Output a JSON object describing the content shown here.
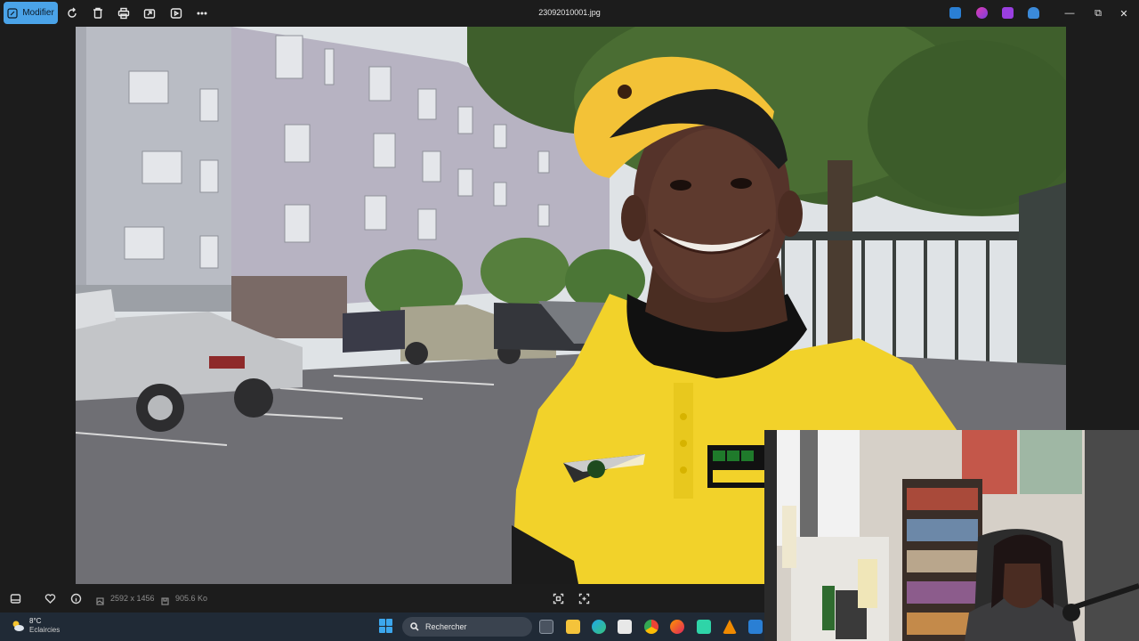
{
  "toolbar": {
    "edit_label": "Modifier",
    "file_name": "23092010001.jpg",
    "icons": [
      "rotate-icon",
      "delete-icon",
      "print-icon",
      "share-icon",
      "slideshow-icon",
      "more-icon"
    ]
  },
  "window_controls": {
    "minimize": "—",
    "maximize": "⧉",
    "close": "✕"
  },
  "status": {
    "dimensions": "2592 x 1456",
    "file_size": "905.6 Ko"
  },
  "taskbar": {
    "weather_temp": "8°C",
    "weather_desc": "Eclaircies",
    "search_placeholder": "Rechercher"
  },
  "colors": {
    "accent": "#4aa3e8",
    "background": "#1c1c1c",
    "taskbar": "#202a36"
  }
}
